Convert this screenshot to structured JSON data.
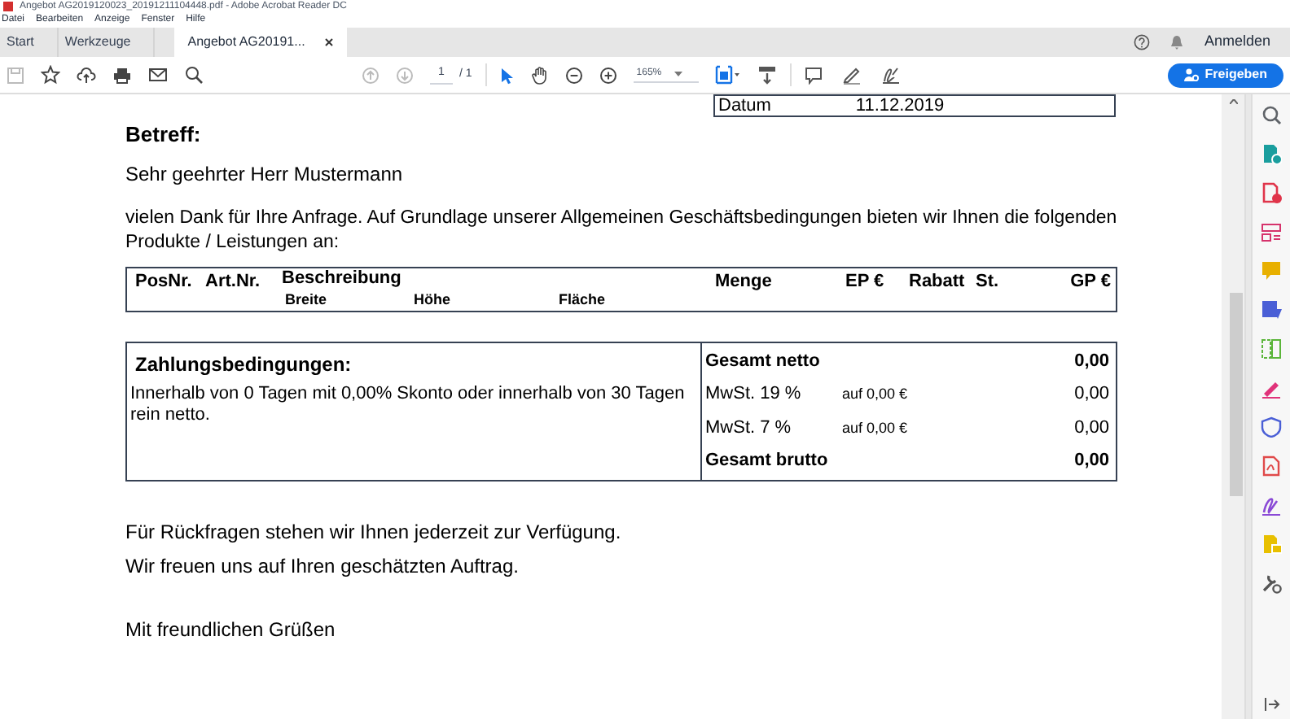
{
  "window": {
    "title": "Angebot AG2019120023_20191211104448.pdf - Adobe Acrobat Reader DC"
  },
  "menu": [
    "Datei",
    "Bearbeiten",
    "Anzeige",
    "Fenster",
    "Hilfe"
  ],
  "tabs": [
    {
      "label": "Start",
      "selected": false,
      "closable": false
    },
    {
      "label": "Werkzeuge",
      "selected": false,
      "closable": false
    },
    {
      "label": "Angebot AG20191...",
      "selected": true,
      "closable": true
    }
  ],
  "account": {
    "sign_in": "Anmelden"
  },
  "toolbar": {
    "page": "1",
    "page_total": "/ 1",
    "zoom": "165%",
    "share": "Freigeben"
  },
  "document": {
    "date_label": "Datum",
    "date_value": "11.12.2019",
    "subject": "Betreff:",
    "salutation": "Sehr geehrter Herr Mustermann",
    "intro": "vielen Dank für Ihre Anfrage. Auf Grundlage unserer Allgemeinen Geschäftsbedingungen bieten wir Ihnen die folgenden Produkte / Leistungen an:",
    "columns": [
      "PosNr.",
      "Art.Nr.",
      "Beschreibung",
      "Menge",
      "EP €",
      "Rabatt",
      "St.",
      "GP €"
    ],
    "subcolumns": [
      "Breite",
      "Höhe",
      "Fläche"
    ],
    "payment_title": "Zahlungsbedingungen:",
    "payment_text": "Innerhalb von 0 Tagen mit 0,00% Skonto oder innerhalb von 30 Tagen rein netto.",
    "totals": [
      {
        "kind": "total",
        "label": "Gesamt netto",
        "value": "0,00"
      },
      {
        "kind": "tax",
        "label": "MwSt. 19 %",
        "basis": "auf 0,00 €",
        "value": "0,00"
      },
      {
        "kind": "tax",
        "label": "MwSt. 7 %",
        "basis": "auf 0,00 €",
        "value": "0,00"
      },
      {
        "kind": "total",
        "label": "Gesamt brutto",
        "value": "0,00"
      }
    ],
    "closing": [
      "Für Rückfragen stehen wir Ihnen jederzeit zur Verfügung.",
      "Wir freuen uns auf Ihren geschätzten Auftrag."
    ],
    "greeting": "Mit freundlichen Grüßen"
  },
  "tools": [
    {
      "color": "#5f6368"
    },
    {
      "color": "#1a9e9e"
    },
    {
      "color": "#e0344a"
    },
    {
      "color": "#d6336c"
    },
    {
      "color": "#e8b000"
    },
    {
      "color": "#4a5fd6"
    },
    {
      "color": "#5bb53a"
    },
    {
      "color": "#e0337a"
    },
    {
      "color": "#4a5fd6"
    },
    {
      "color": "#e04a4a"
    },
    {
      "color": "#8a4ad6"
    },
    {
      "color": "#e8c000"
    },
    {
      "color": "#555555"
    }
  ]
}
